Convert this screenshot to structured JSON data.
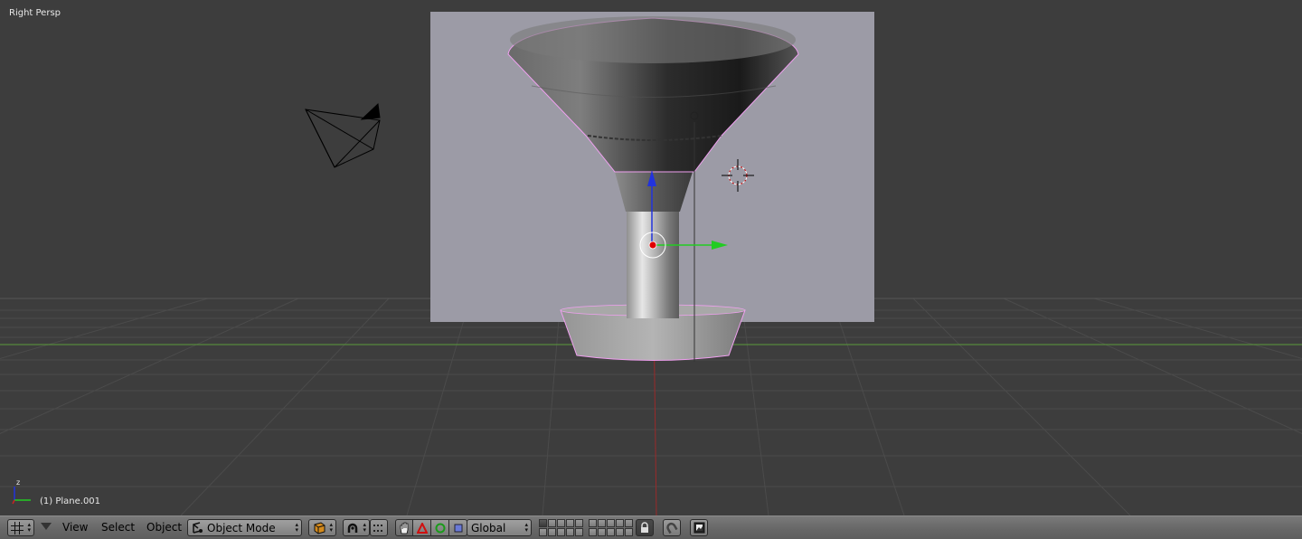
{
  "viewport": {
    "view_label": "Right Persp",
    "object_info": "(1) Plane.001",
    "axis_label": "z"
  },
  "header": {
    "menus": {
      "view": "View",
      "select": "Select",
      "object": "Object"
    },
    "mode_select": "Object Mode",
    "orientation_select": "Global"
  },
  "icons": {
    "editor_type": "grid-icon",
    "menu_collapse": "triangle-down-icon",
    "mode": "object-mode-icon",
    "draw_type": "solid-shading-icon",
    "pivot": "pivot-icon",
    "manipulator": "hand-manipulator-icon",
    "translate": "translate-icon",
    "rotate": "rotate-icon",
    "scale": "scale-icon",
    "lock": "lock-icon",
    "snap": "snap-icon",
    "render": "render-icon"
  },
  "colors": {
    "background": "#3d3d3d",
    "grid": "#4a4a4a",
    "x_axis": "#5a9a3a",
    "y_axis": "#9a2a2a",
    "backdrop_plane": "#9c9ba6",
    "selection_outline": "#f0a0f0",
    "header": "#727272"
  }
}
